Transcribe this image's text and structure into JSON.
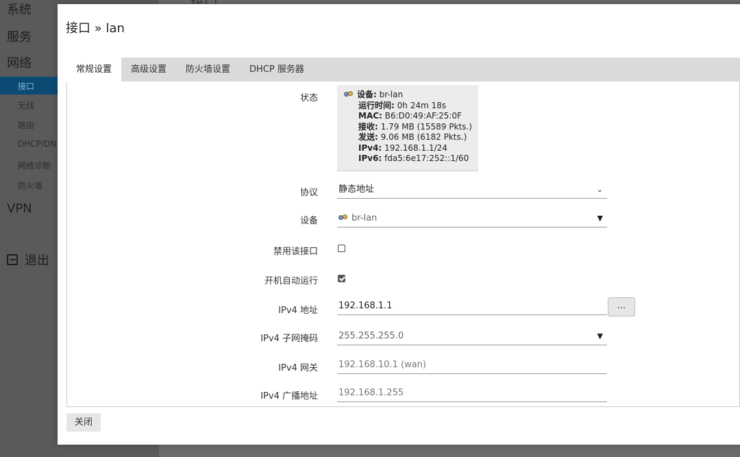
{
  "background": {
    "page_title": "接口",
    "sidebar": {
      "top_items": [
        "系统",
        "服务",
        "网络"
      ],
      "sub_items": [
        "接口",
        "无线",
        "路由",
        "DHCP/DN",
        "网络诊断",
        "防火墙"
      ],
      "vpn": "VPN",
      "logout": "退出"
    }
  },
  "modal": {
    "title": "接口 » lan",
    "tabs": [
      "常规设置",
      "高级设置",
      "防火墙设置",
      "DHCP 服务器"
    ],
    "active_tab": 0,
    "status": {
      "label": "状态",
      "device_key": "设备:",
      "device_val": "br-lan",
      "uptime_key": "运行时间:",
      "uptime_val": "0h 24m 18s",
      "mac_key": "MAC:",
      "mac_val": "B6:D0:49:AF:25:0F",
      "rx_key": "接收:",
      "rx_val": "1.79 MB (15589 Pkts.)",
      "tx_key": "发送:",
      "tx_val": "9.06 MB (6182 Pkts.)",
      "ipv4_key": "IPv4:",
      "ipv4_val": "192.168.1.1/24",
      "ipv6_key": "IPv6:",
      "ipv6_val": "fda5:6e17:252::1/60"
    },
    "protocol": {
      "label": "协议",
      "value": "静态地址"
    },
    "device": {
      "label": "设备",
      "value": "br-lan"
    },
    "disable_iface": {
      "label": "禁用该接口",
      "checked": false
    },
    "autostart": {
      "label": "开机自动运行",
      "checked": true
    },
    "ipv4_addr": {
      "label": "IPv4 地址",
      "value": "192.168.1.1",
      "button": "..."
    },
    "ipv4_mask": {
      "label": "IPv4 子网掩码",
      "value": "255.255.255.0"
    },
    "ipv4_gw": {
      "label": "IPv4 网关",
      "placeholder": "192.168.10.1 (wan)"
    },
    "ipv4_bcast": {
      "label": "IPv4 广播地址",
      "placeholder": "192.168.1.255"
    },
    "close_label": "关闭"
  }
}
